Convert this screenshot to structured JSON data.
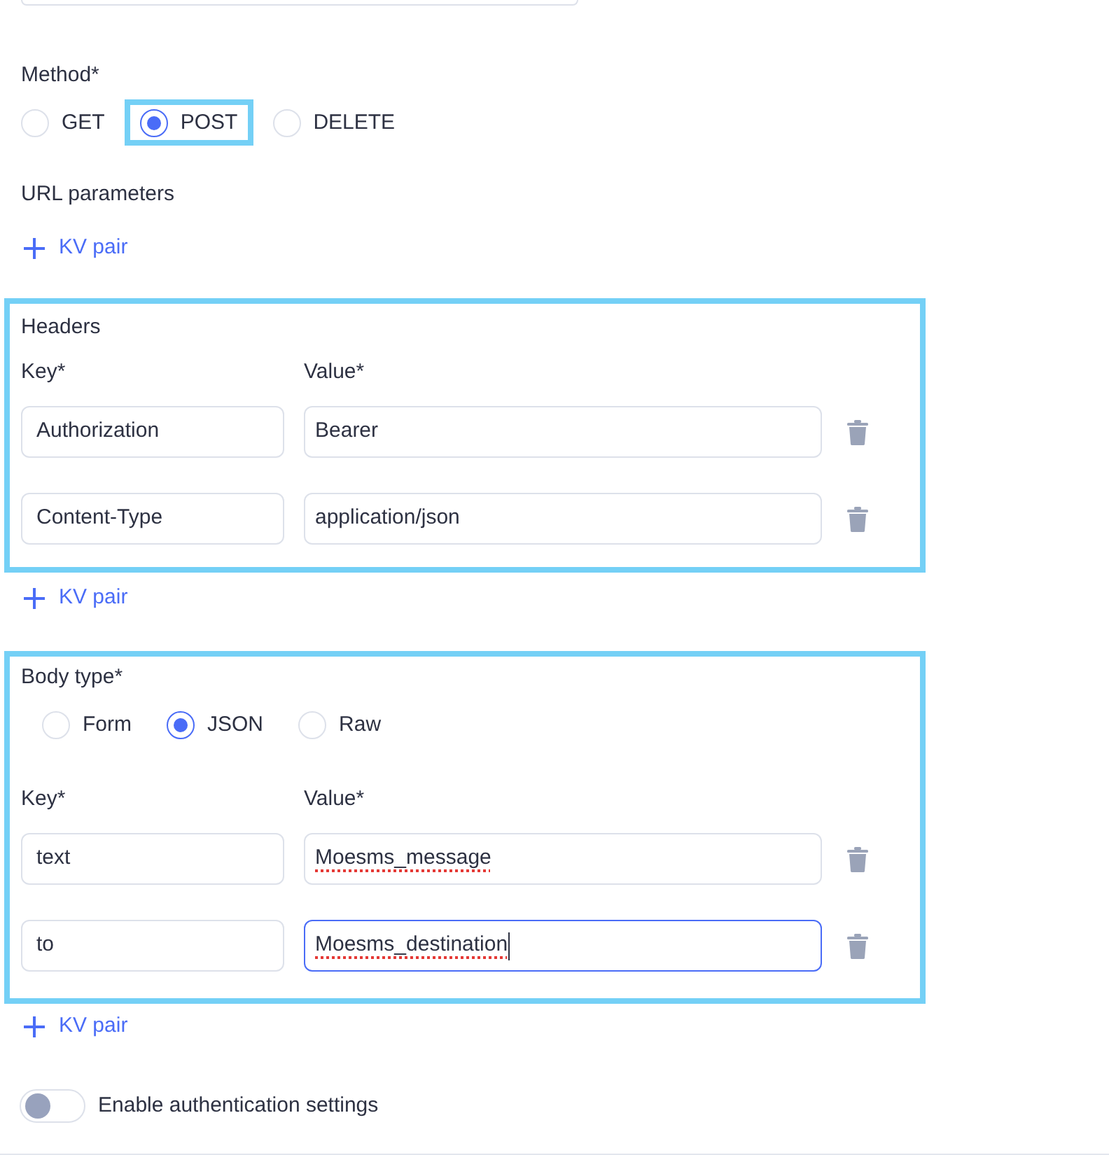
{
  "method": {
    "label": "Method*",
    "options": [
      {
        "kind": "plain",
        "label": "GET",
        "selected": false
      },
      {
        "kind": "framed",
        "label": "POST",
        "selected": true
      },
      {
        "kind": "plain",
        "label": "DELETE",
        "selected": false
      }
    ]
  },
  "url_parameters": {
    "label": "URL parameters",
    "add_button": "KV pair"
  },
  "headers": {
    "highlighted": true,
    "title": "Headers",
    "key_label": "Key*",
    "value_label": "Value*",
    "rows": [
      {
        "key": "Authorization",
        "value": "Bearer",
        "focused": false,
        "misspelled": false
      },
      {
        "key": "Content-Type",
        "value": "application/json",
        "focused": false,
        "misspelled": false
      }
    ],
    "add_button": "KV pair"
  },
  "body": {
    "highlighted": true,
    "label": "Body type*",
    "options": [
      {
        "kind": "plain",
        "label": "Form",
        "selected": false
      },
      {
        "kind": "plain",
        "label": "JSON",
        "selected": true
      },
      {
        "kind": "plain",
        "label": "Raw",
        "selected": false
      }
    ],
    "key_label": "Key*",
    "value_label": "Value*",
    "rows": [
      {
        "key": "text",
        "value": "Moesms_message",
        "focused": false,
        "misspelled": true
      },
      {
        "key": "to",
        "value": "Moesms_destination",
        "focused": true,
        "misspelled": true
      }
    ],
    "add_button": "KV pair"
  },
  "auth_toggle": {
    "label": "Enable authentication settings",
    "on": false
  }
}
